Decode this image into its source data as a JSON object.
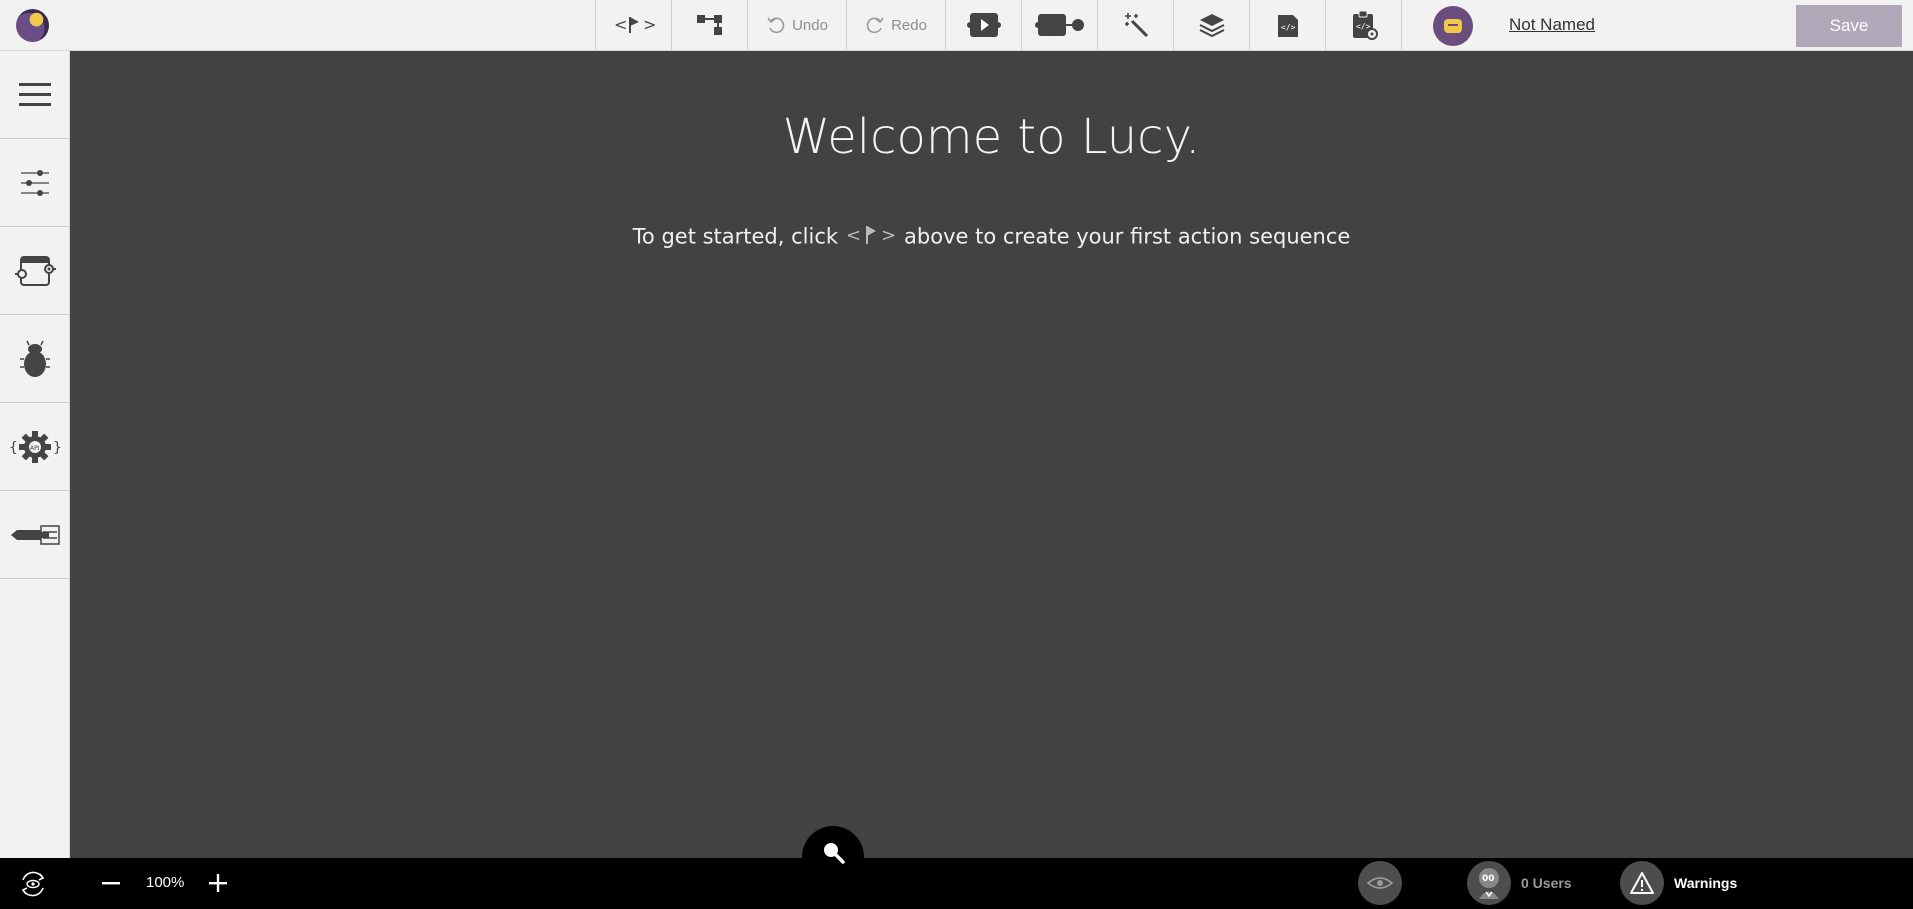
{
  "header": {
    "undo_label": "Undo",
    "redo_label": "Redo",
    "project_name": "Not Named",
    "save_label": "Save"
  },
  "canvas": {
    "welcome_title": "Welcome to Lucy.",
    "instructions_before": "To get started, click",
    "instructions_after": "above to create your first action sequence"
  },
  "bottombar": {
    "zoom_level": "100%",
    "users_count_label": "0 Users",
    "warnings_label": "Warnings"
  },
  "icons": {
    "logo": "lucy-logo",
    "toolbar": [
      "action-sequence-icon",
      "flowchart-icon",
      "undo-icon",
      "redo-icon",
      "player-icon",
      "connector-icon",
      "magic-wand-icon",
      "layers-icon",
      "code-page-icon",
      "code-clipboard-icon"
    ],
    "sidebar": [
      "hamburger-menu-icon",
      "sliders-icon",
      "module-icon",
      "bug-icon",
      "api-gear-icon",
      "marker-icon"
    ]
  },
  "colors": {
    "canvas_bg": "#424242",
    "save_button": "#b0a7b8",
    "avatar": "#6b4d7e",
    "bottom_bar": "#000000"
  }
}
